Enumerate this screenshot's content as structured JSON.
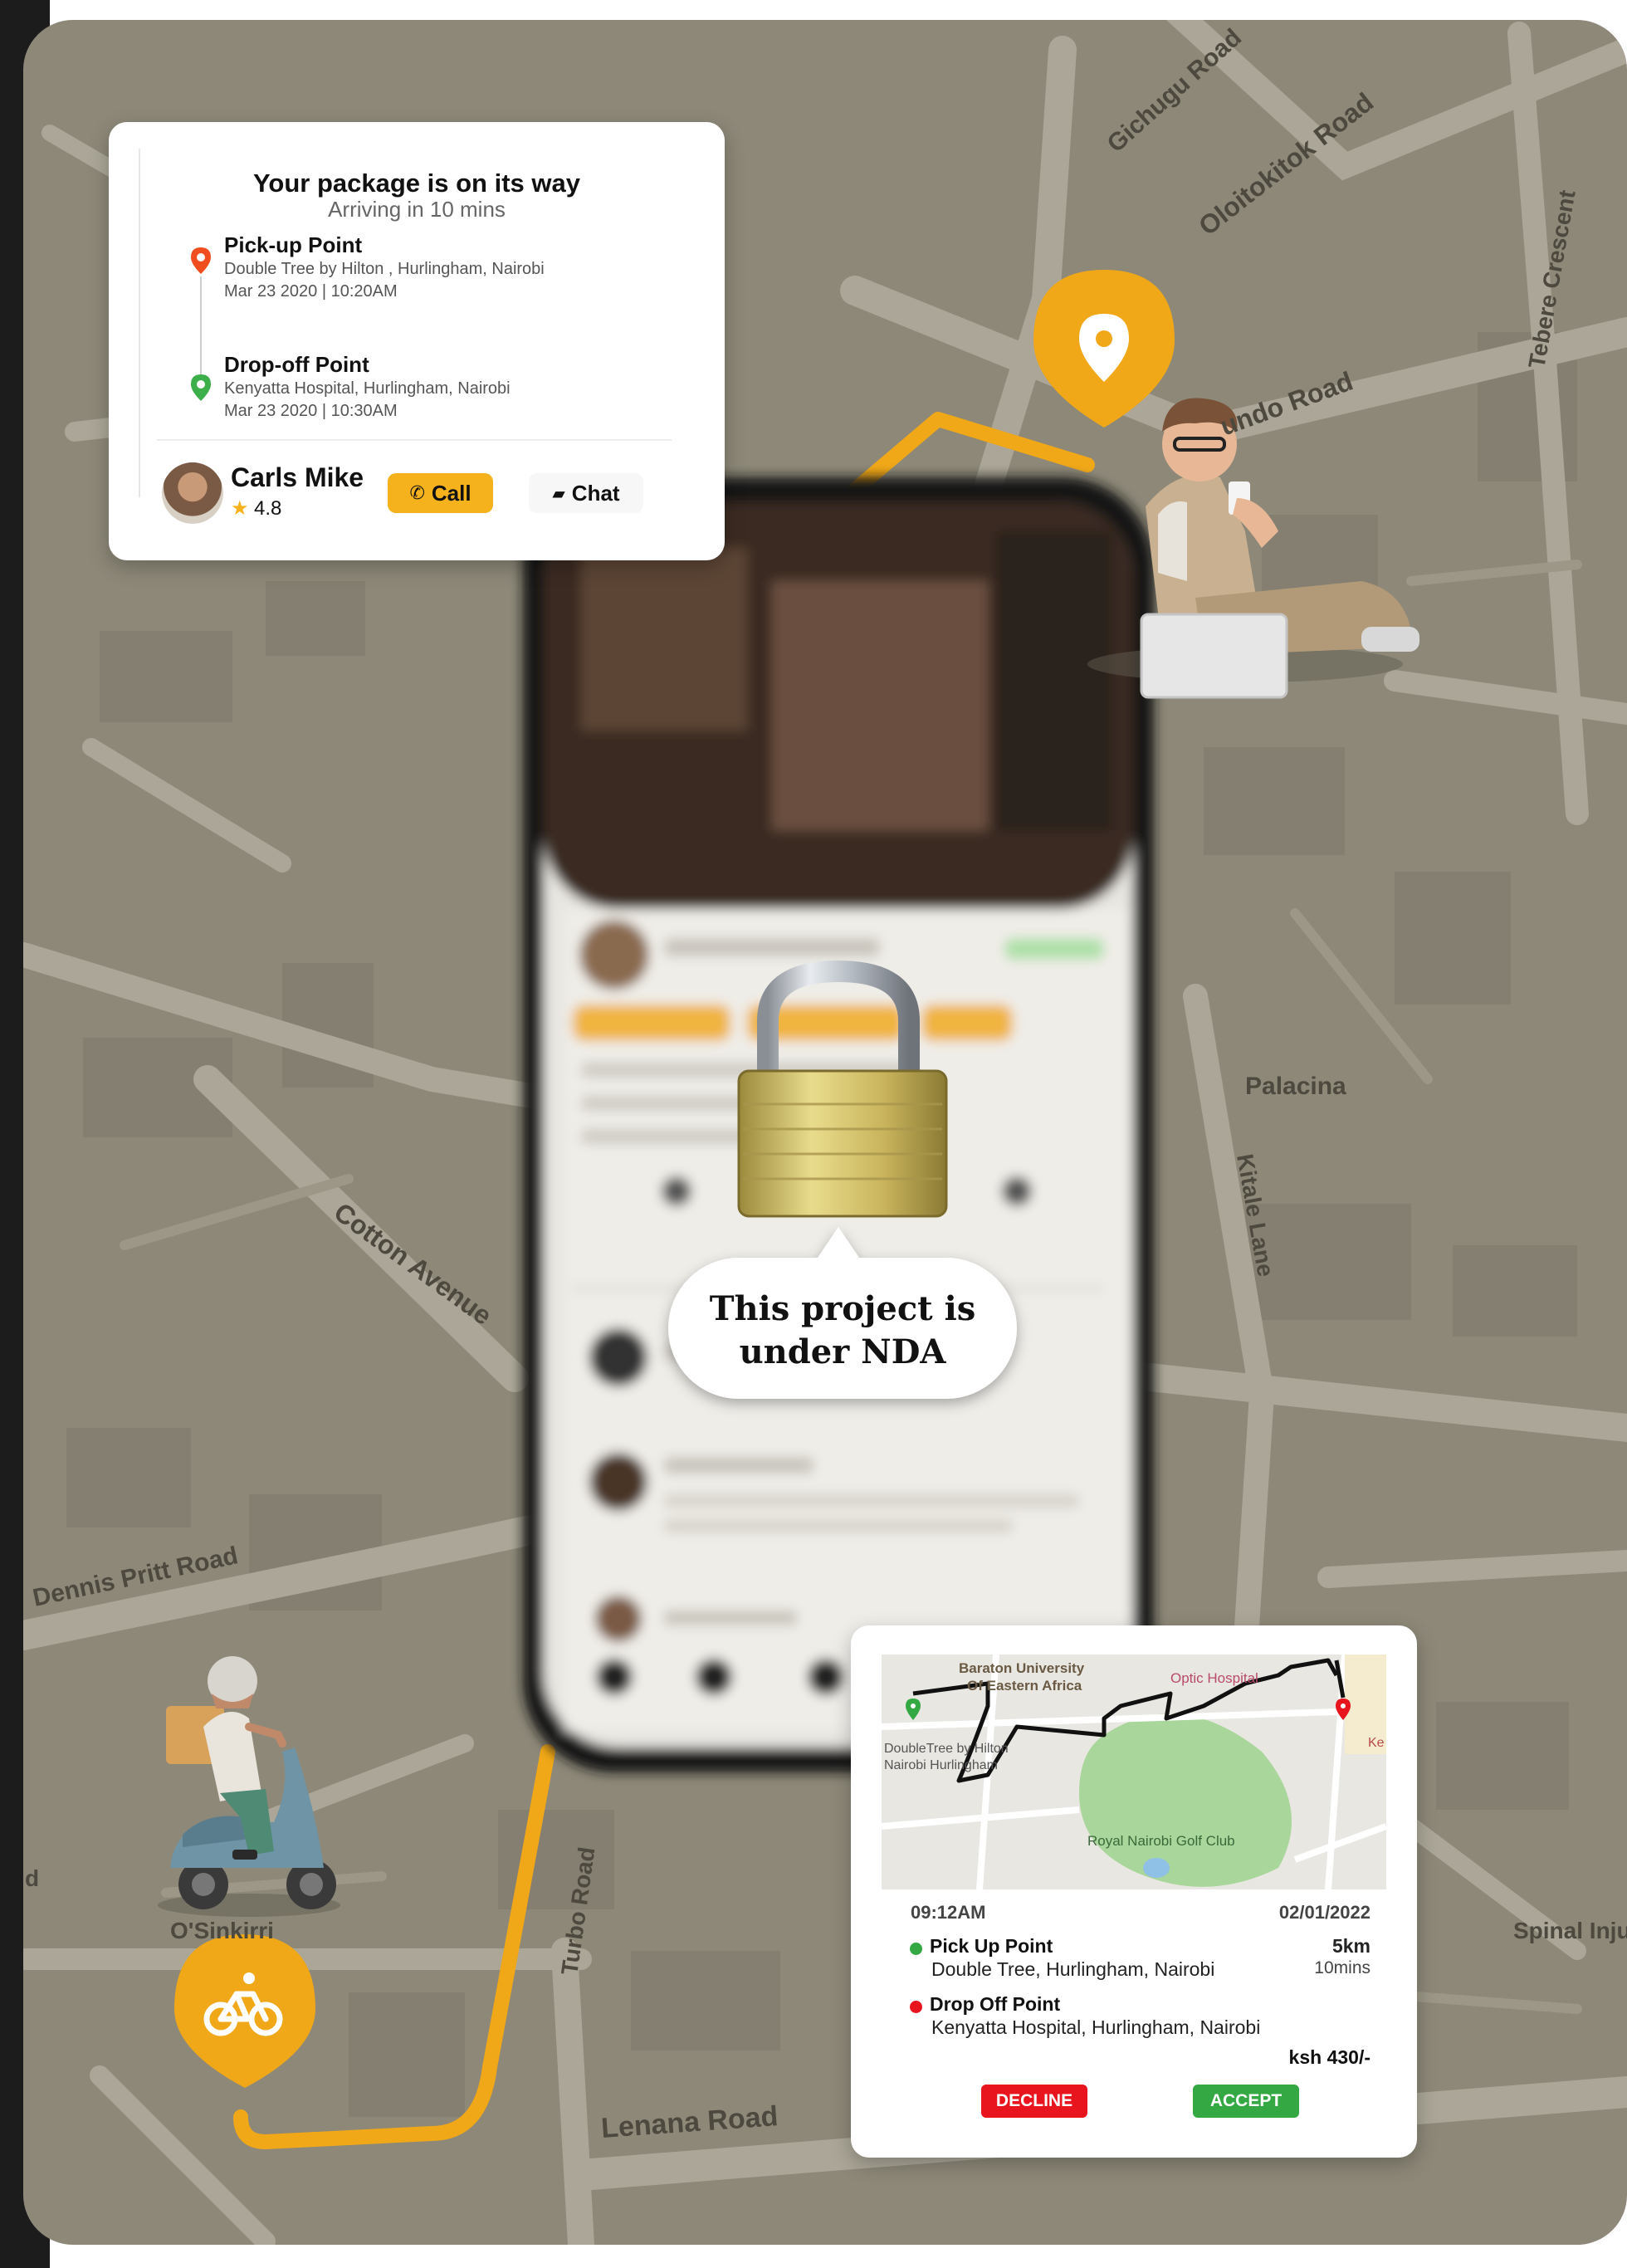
{
  "map": {
    "street_labels": [
      "Gichugu Road",
      "Oloitokitok Road",
      "Tebere Crescent",
      "undo Road",
      "Palacina",
      "Kitale Lane",
      "Cotton Avenue",
      "Dennis Pritt Road",
      "O'Sinkirri",
      "Turbo Road",
      "Lenana Road",
      "Spinal Inju",
      "d"
    ],
    "colors": {
      "base": "#8d8878",
      "road": "#aba697",
      "road_edge": "#9c9787",
      "accent": "#f0a818"
    }
  },
  "tracking_card": {
    "title": "Your package is on its way",
    "subtitle": "Arriving in 10 mins",
    "pickup": {
      "label": "Pick-up Point",
      "address": "Double Tree by Hilton , Hurlingham, Nairobi",
      "datetime": "Mar 23 2020 | 10:20AM"
    },
    "dropoff": {
      "label": "Drop-off Point",
      "address": "Kenyatta Hospital, Hurlingham, Nairobi",
      "datetime": "Mar 23 2020 | 10:30AM"
    },
    "driver": {
      "name": "Carls Mike",
      "rating": "4.8"
    },
    "call_label": "Call",
    "chat_label": "Chat",
    "colors": {
      "pickup_pin": "#f04e1e",
      "dropoff_pin": "#3cae4a",
      "button": "#f5b21c",
      "star": "#f5b21c"
    }
  },
  "nda": {
    "line1": "This project is",
    "line2": "under NDA"
  },
  "request_card": {
    "map_labels": [
      "Baraton University",
      "Of Eastern Africa",
      "Optic Hospital",
      "DoubleTree by Hilton",
      "Nairobi Hurlingham",
      "Royal Nairobi Golf Club",
      "Ke"
    ],
    "time": "09:12AM",
    "date": "02/01/2022",
    "pickup": {
      "label": "Pick Up Point",
      "address": "Double Tree, Hurlingham, Nairobi",
      "distance": "5km",
      "duration": "10mins"
    },
    "dropoff": {
      "label": "Drop Off Point",
      "address": "Kenyatta Hospital, Hurlingham, Nairobi"
    },
    "price": "ksh 430/-",
    "decline_label": "DECLINE",
    "accept_label": "ACCEPT",
    "colors": {
      "decline": "#e8141e",
      "accept": "#33a843",
      "pickup_dot": "#33a843",
      "dropoff_dot": "#e8141e"
    }
  },
  "icons": [
    "location-pin-icon",
    "bicycle-icon",
    "padlock-icon",
    "phone-icon",
    "chat-icon",
    "star-icon"
  ]
}
